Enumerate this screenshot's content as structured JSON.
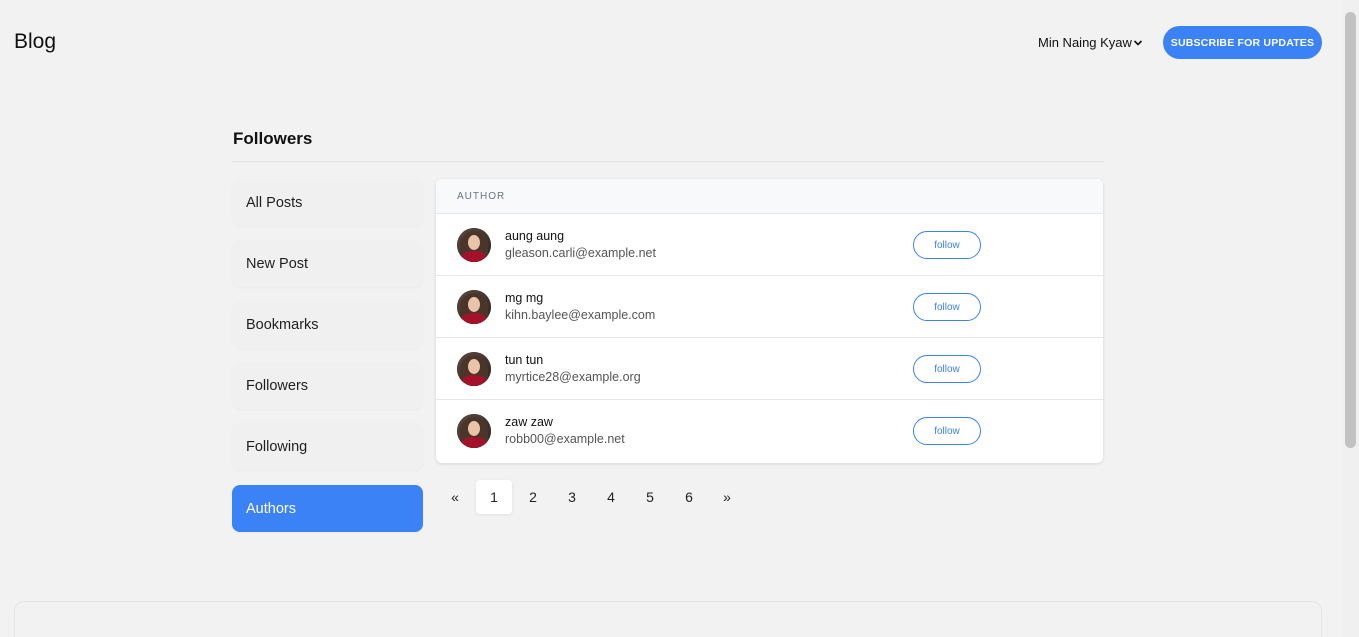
{
  "header": {
    "brand": "Blog",
    "user_name": "Min Naing Kyaw",
    "subscribe_label": "SUBSCRIBE FOR UPDATES"
  },
  "page": {
    "title": "Followers"
  },
  "sidebar": {
    "items": [
      {
        "label": "All Posts",
        "active": false
      },
      {
        "label": "New Post",
        "active": false
      },
      {
        "label": "Bookmarks",
        "active": false
      },
      {
        "label": "Followers",
        "active": false
      },
      {
        "label": "Following",
        "active": false
      },
      {
        "label": "Authors",
        "active": true
      }
    ]
  },
  "table": {
    "column_header": "AUTHOR",
    "rows": [
      {
        "name": "aung aung",
        "email": "gleason.carli@example.net",
        "action": "follow"
      },
      {
        "name": "mg mg",
        "email": "kihn.baylee@example.com",
        "action": "follow"
      },
      {
        "name": "tun tun",
        "email": "myrtice28@example.org",
        "action": "follow"
      },
      {
        "name": "zaw zaw",
        "email": "robb00@example.net",
        "action": "follow"
      }
    ]
  },
  "pagination": {
    "prev": "«",
    "pages": [
      "1",
      "2",
      "3",
      "4",
      "5",
      "6"
    ],
    "current": "1",
    "next": "»"
  },
  "colors": {
    "accent": "#3b82f6",
    "background": "#f2f2f2"
  }
}
